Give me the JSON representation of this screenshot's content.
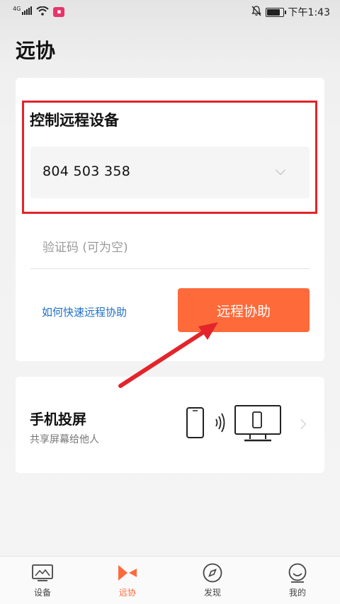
{
  "status_bar": {
    "network": "4G",
    "time": "下午1:43"
  },
  "page": {
    "title": "远协"
  },
  "control_card": {
    "title": "控制远程设备",
    "device_id": "804 503 358",
    "verify_placeholder": "验证码 (可为空)",
    "help_link": "如何快速远程协助",
    "assist_button": "远程协助"
  },
  "cast_card": {
    "title": "手机投屏",
    "subtitle": "共享屏幕给他人"
  },
  "bottom_nav": {
    "items": [
      {
        "label": "设备",
        "icon": "monitor-icon"
      },
      {
        "label": "远协",
        "icon": "remote-assist-icon"
      },
      {
        "label": "发现",
        "icon": "compass-icon"
      },
      {
        "label": "我的",
        "icon": "profile-icon"
      }
    ],
    "active": "远协"
  },
  "colors": {
    "accent": "#ff6a3a",
    "link": "#1f6fc6",
    "annotation": "#e3242b"
  }
}
